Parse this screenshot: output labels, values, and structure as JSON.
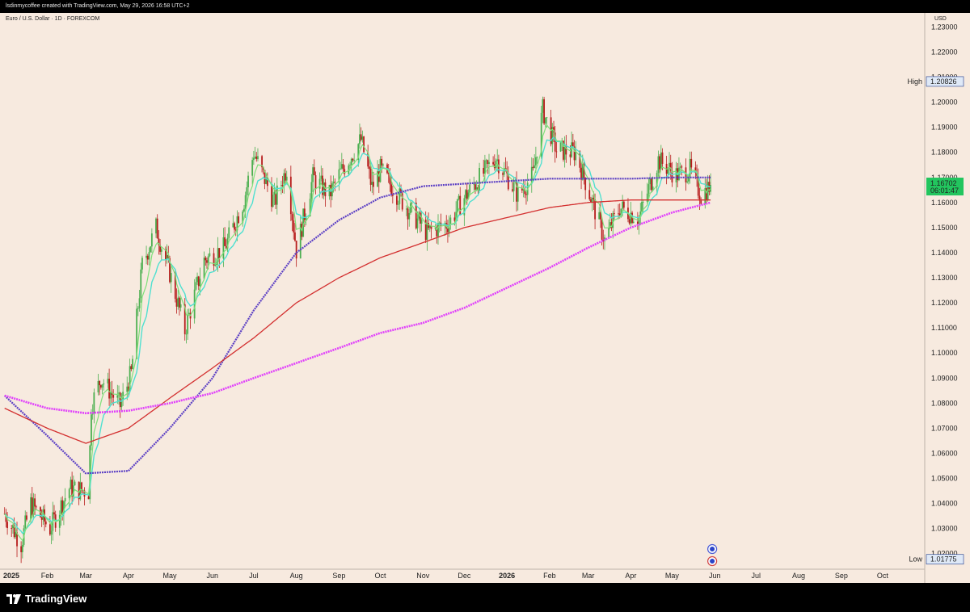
{
  "header": {
    "attribution": "lsdinmycoffee created with TradingView.com, May 29, 2026 16:58 UTC+2",
    "symbol": "Euro / U.S. Dollar · 1D · FOREXCOM",
    "currency": "USD"
  },
  "footer": {
    "brand": "TradingView"
  },
  "colors": {
    "background": "#f7eadf",
    "candle_up": "#4caf50",
    "candle_down": "#b71c1c",
    "ma_fast": "#7ee07a",
    "ma_mid": "#4fe0d0",
    "ma_purple": "#5b3fc4",
    "ma_red": "#d32f2f",
    "ma_magenta": "#e040fb",
    "price_label": "#22c55e"
  },
  "chart_data": {
    "type": "candlestick",
    "ylim": [
      1.0138,
      1.2356
    ],
    "yticks": [
      "1.23000",
      "1.22000",
      "1.21000",
      "1.20000",
      "1.19000",
      "1.18000",
      "1.17000",
      "1.16000",
      "1.15000",
      "1.14000",
      "1.13000",
      "1.12000",
      "1.11000",
      "1.10000",
      "1.09000",
      "1.08000",
      "1.07000",
      "1.06000",
      "1.05000",
      "1.04000",
      "1.03000",
      "1.02000"
    ],
    "xlim": [
      "2024-12-31",
      "2026-10-31"
    ],
    "xticks": [
      {
        "label": "2025",
        "date": "2025-01-01",
        "bold": true
      },
      {
        "label": "Feb",
        "date": "2025-02-01"
      },
      {
        "label": "Mar",
        "date": "2025-03-01"
      },
      {
        "label": "Apr",
        "date": "2025-04-01"
      },
      {
        "label": "May",
        "date": "2025-05-01"
      },
      {
        "label": "Jun",
        "date": "2025-06-01"
      },
      {
        "label": "Jul",
        "date": "2025-07-01"
      },
      {
        "label": "Aug",
        "date": "2025-08-01"
      },
      {
        "label": "Sep",
        "date": "2025-09-01"
      },
      {
        "label": "Oct",
        "date": "2025-10-01"
      },
      {
        "label": "Nov",
        "date": "2025-11-01"
      },
      {
        "label": "Dec",
        "date": "2025-12-01"
      },
      {
        "label": "2026",
        "date": "2026-01-01",
        "bold": true
      },
      {
        "label": "Feb",
        "date": "2026-02-01"
      },
      {
        "label": "Mar",
        "date": "2026-03-01"
      },
      {
        "label": "Apr",
        "date": "2026-04-01"
      },
      {
        "label": "May",
        "date": "2026-05-01"
      },
      {
        "label": "Jun",
        "date": "2026-06-01"
      },
      {
        "label": "Jul",
        "date": "2026-07-01"
      },
      {
        "label": "Aug",
        "date": "2026-08-01"
      },
      {
        "label": "Sep",
        "date": "2026-09-01"
      },
      {
        "label": "Oct",
        "date": "2026-10-01"
      }
    ],
    "close_path": [
      [
        "2025-01-01",
        1.036
      ],
      [
        "2025-01-13",
        1.024
      ],
      [
        "2025-01-20",
        1.04
      ],
      [
        "2025-02-03",
        1.03
      ],
      [
        "2025-02-17",
        1.046
      ],
      [
        "2025-03-03",
        1.045
      ],
      [
        "2025-03-05",
        1.079
      ],
      [
        "2025-03-12",
        1.09
      ],
      [
        "2025-03-26",
        1.079
      ],
      [
        "2025-04-03",
        1.092
      ],
      [
        "2025-04-11",
        1.135
      ],
      [
        "2025-04-21",
        1.15
      ],
      [
        "2025-05-01",
        1.132
      ],
      [
        "2025-05-12",
        1.109
      ],
      [
        "2025-05-26",
        1.137
      ],
      [
        "2025-06-10",
        1.142
      ],
      [
        "2025-06-24",
        1.161
      ],
      [
        "2025-07-01",
        1.18
      ],
      [
        "2025-07-16",
        1.16
      ],
      [
        "2025-07-25",
        1.174
      ],
      [
        "2025-08-01",
        1.141
      ],
      [
        "2025-08-13",
        1.17
      ],
      [
        "2025-08-25",
        1.163
      ],
      [
        "2025-09-01",
        1.171
      ],
      [
        "2025-09-17",
        1.185
      ],
      [
        "2025-09-25",
        1.166
      ],
      [
        "2025-10-01",
        1.173
      ],
      [
        "2025-10-15",
        1.162
      ],
      [
        "2025-11-04",
        1.148
      ],
      [
        "2025-11-20",
        1.152
      ],
      [
        "2025-12-01",
        1.162
      ],
      [
        "2025-12-24",
        1.178
      ],
      [
        "2026-01-09",
        1.163
      ],
      [
        "2026-01-20",
        1.171
      ],
      [
        "2026-01-27",
        1.197
      ],
      [
        "2026-02-06",
        1.181
      ],
      [
        "2026-02-20",
        1.18
      ],
      [
        "2026-03-03",
        1.162
      ],
      [
        "2026-03-13",
        1.145
      ],
      [
        "2026-03-24",
        1.158
      ],
      [
        "2026-04-07",
        1.154
      ],
      [
        "2026-04-21",
        1.177
      ],
      [
        "2026-05-04",
        1.171
      ],
      [
        "2026-05-14",
        1.173
      ],
      [
        "2026-05-22",
        1.163
      ],
      [
        "2026-05-29",
        1.16702
      ]
    ],
    "series": [
      {
        "name": "",
        "color": "#5b3fc4",
        "points": [
          [
            "2025-01-01",
            1.083
          ],
          [
            "2025-02-01",
            1.067
          ],
          [
            "2025-03-01",
            1.052
          ],
          [
            "2025-04-01",
            1.053
          ],
          [
            "2025-05-01",
            1.07
          ],
          [
            "2025-06-01",
            1.09
          ],
          [
            "2025-07-01",
            1.117
          ],
          [
            "2025-08-01",
            1.14
          ],
          [
            "2025-09-01",
            1.153
          ],
          [
            "2025-10-01",
            1.162
          ],
          [
            "2025-11-01",
            1.1665
          ],
          [
            "2025-12-01",
            1.1675
          ],
          [
            "2026-01-01",
            1.1685
          ],
          [
            "2026-02-01",
            1.1695
          ],
          [
            "2026-03-01",
            1.1695
          ],
          [
            "2026-04-01",
            1.1695
          ],
          [
            "2026-05-01",
            1.17
          ],
          [
            "2026-05-29",
            1.17
          ]
        ]
      },
      {
        "name": "",
        "color": "#d32f2f",
        "points": [
          [
            "2025-01-01",
            1.078
          ],
          [
            "2025-02-01",
            1.07
          ],
          [
            "2025-03-01",
            1.064
          ],
          [
            "2025-04-01",
            1.07
          ],
          [
            "2025-05-01",
            1.082
          ],
          [
            "2025-06-01",
            1.094
          ],
          [
            "2025-07-01",
            1.106
          ],
          [
            "2025-08-01",
            1.12
          ],
          [
            "2025-09-01",
            1.13
          ],
          [
            "2025-10-01",
            1.138
          ],
          [
            "2025-11-01",
            1.144
          ],
          [
            "2025-12-01",
            1.15
          ],
          [
            "2026-01-01",
            1.154
          ],
          [
            "2026-02-01",
            1.158
          ],
          [
            "2026-03-01",
            1.16
          ],
          [
            "2026-04-01",
            1.161
          ],
          [
            "2026-05-01",
            1.161
          ],
          [
            "2026-05-29",
            1.161
          ]
        ]
      },
      {
        "name": "",
        "color": "#e040fb",
        "points": [
          [
            "2025-01-01",
            1.083
          ],
          [
            "2025-02-01",
            1.078
          ],
          [
            "2025-03-01",
            1.076
          ],
          [
            "2025-04-01",
            1.077
          ],
          [
            "2025-05-01",
            1.08
          ],
          [
            "2025-06-01",
            1.084
          ],
          [
            "2025-07-01",
            1.09
          ],
          [
            "2025-08-01",
            1.096
          ],
          [
            "2025-09-01",
            1.102
          ],
          [
            "2025-10-01",
            1.108
          ],
          [
            "2025-11-01",
            1.112
          ],
          [
            "2025-12-01",
            1.118
          ],
          [
            "2026-01-01",
            1.126
          ],
          [
            "2026-02-01",
            1.134
          ],
          [
            "2026-03-01",
            1.142
          ],
          [
            "2026-04-01",
            1.15
          ],
          [
            "2026-05-01",
            1.156
          ],
          [
            "2026-05-29",
            1.16
          ]
        ]
      }
    ],
    "high": {
      "label": "High",
      "value": "1.20826"
    },
    "low": {
      "label": "Low",
      "value": "1.01775"
    },
    "last": {
      "value": "1.16702",
      "countdown": "06:01:47"
    }
  }
}
